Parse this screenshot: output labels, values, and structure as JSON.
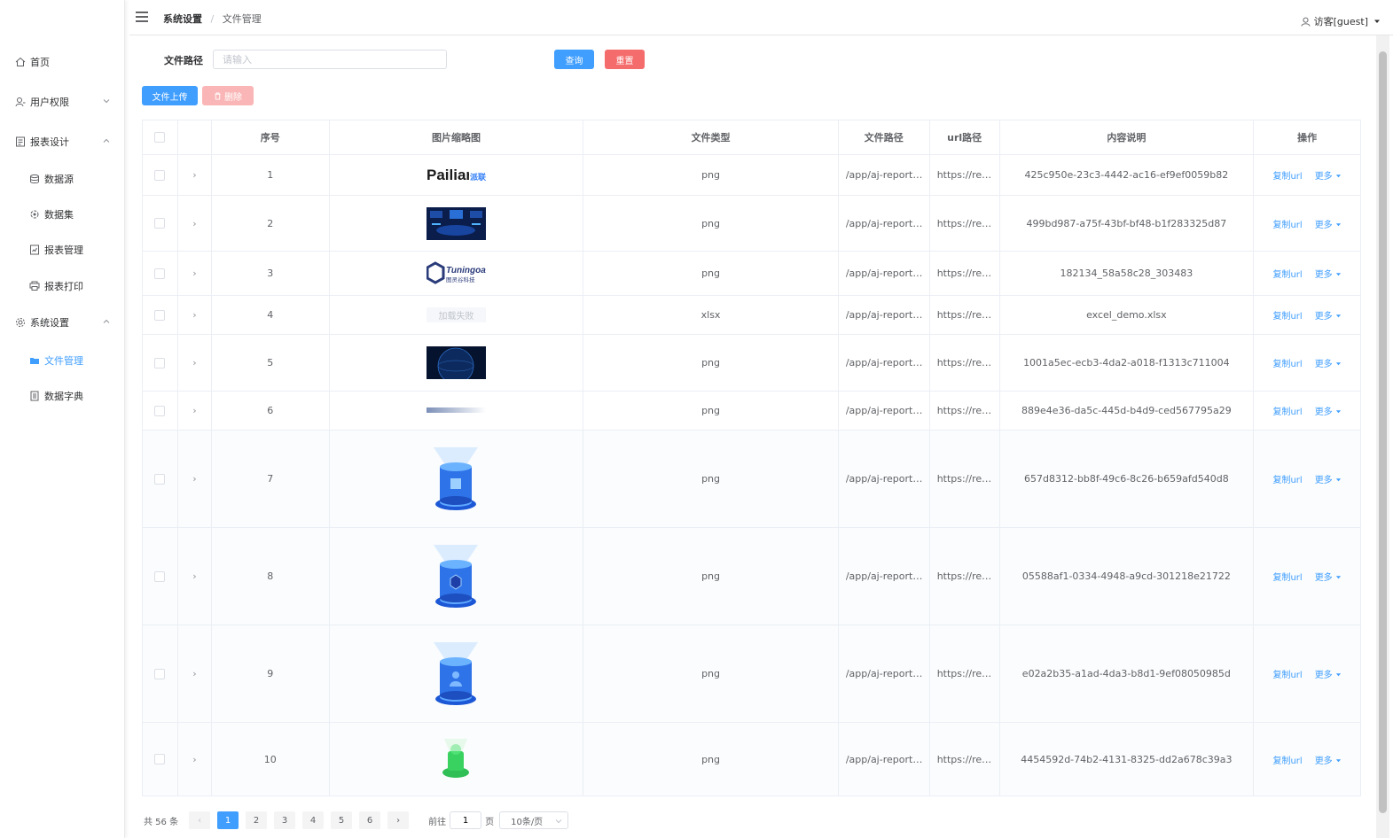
{
  "sidebar": {
    "items": [
      {
        "label": "首页",
        "icon": "home-icon"
      },
      {
        "label": "用户权限",
        "icon": "user-icon"
      },
      {
        "label": "报表设计",
        "icon": "report-icon"
      },
      {
        "label": "数据源",
        "icon": "database-icon"
      },
      {
        "label": "数据集",
        "icon": "dataset-icon"
      },
      {
        "label": "报表管理",
        "icon": "report-manage-icon"
      },
      {
        "label": "报表打印",
        "icon": "print-icon"
      },
      {
        "label": "系统设置",
        "icon": "gear-icon"
      },
      {
        "label": "文件管理",
        "icon": "folder-icon"
      },
      {
        "label": "数据字典",
        "icon": "dictionary-icon"
      }
    ]
  },
  "header": {
    "breadcrumb": [
      "系统设置",
      "文件管理"
    ],
    "user": "访客[guest]"
  },
  "search": {
    "label": "文件路径",
    "placeholder": "请输入",
    "query_label": "查询",
    "reset_label": "重置"
  },
  "toolbar": {
    "upload_label": "文件上传",
    "delete_label": "删除"
  },
  "table": {
    "columns": [
      "序号",
      "图片缩略图",
      "文件类型",
      "文件路径",
      "url路径",
      "内容说明",
      "操作"
    ],
    "copy_label": "复制url",
    "more_label": "更多",
    "load_failed_label": "加载失败",
    "logo_text_1": "Pailian",
    "logo_text_1b": "派联",
    "logo_text_3": "Tuningoal",
    "logo_text_3b": "图灵谷科技",
    "rows": [
      {
        "no": "1",
        "type": "png",
        "path": "/app/aj-report/i...",
        "url": "https://rep...",
        "desc": "425c950e-23c3-4442-ac16-ef9ef0059b82",
        "thumb": "logo-pailian"
      },
      {
        "no": "2",
        "type": "png",
        "path": "/app/aj-report/i...",
        "url": "https://rep...",
        "desc": "499bd987-a75f-43bf-bf48-b1f283325d87",
        "thumb": "dashboard"
      },
      {
        "no": "3",
        "type": "png",
        "path": "/app/aj-report/i...",
        "url": "https://rep...",
        "desc": "182134_58a58c28_303483",
        "thumb": "logo-tuningoal"
      },
      {
        "no": "4",
        "type": "xlsx",
        "path": "/app/aj-report/i...",
        "url": "https://rep...",
        "desc": "excel_demo.xlsx",
        "thumb": "failed"
      },
      {
        "no": "5",
        "type": "png",
        "path": "/app/aj-report/i...",
        "url": "https://rep...",
        "desc": "1001a5ec-ecb3-4da2-a018-f1313c711004",
        "thumb": "globe"
      },
      {
        "no": "6",
        "type": "png",
        "path": "/app/aj-report/i...",
        "url": "https://rep...",
        "desc": "889e4e36-da5c-445d-b4d9-ced567795a29",
        "thumb": "bar"
      },
      {
        "no": "7",
        "type": "png",
        "path": "/app/aj-report/i...",
        "url": "https://rep...",
        "desc": "657d8312-bb8f-49c6-8c26-b659afd540d8",
        "thumb": "cylinder-cube"
      },
      {
        "no": "8",
        "type": "png",
        "path": "/app/aj-report/i...",
        "url": "https://rep...",
        "desc": "05588af1-0334-4948-a9cd-301218e21722",
        "thumb": "cylinder-box"
      },
      {
        "no": "9",
        "type": "png",
        "path": "/app/aj-report/i...",
        "url": "https://rep...",
        "desc": "e02a2b35-a1ad-4da3-b8d1-9ef08050985d",
        "thumb": "cylinder-person"
      },
      {
        "no": "10",
        "type": "png",
        "path": "/app/aj-report/i...",
        "url": "https://rep...",
        "desc": "4454592d-74b2-4131-8325-dd2a678c39a3",
        "thumb": "green-puzzle"
      }
    ]
  },
  "pagination": {
    "total_label": "共 56 条",
    "pages": [
      "1",
      "2",
      "3",
      "4",
      "5",
      "6"
    ],
    "current": "1",
    "goto_label": "前往",
    "goto_value": "1",
    "page_suffix": "页",
    "page_size": "10条/页"
  },
  "colors": {
    "primary": "#409eff",
    "danger": "#f56c6c"
  }
}
